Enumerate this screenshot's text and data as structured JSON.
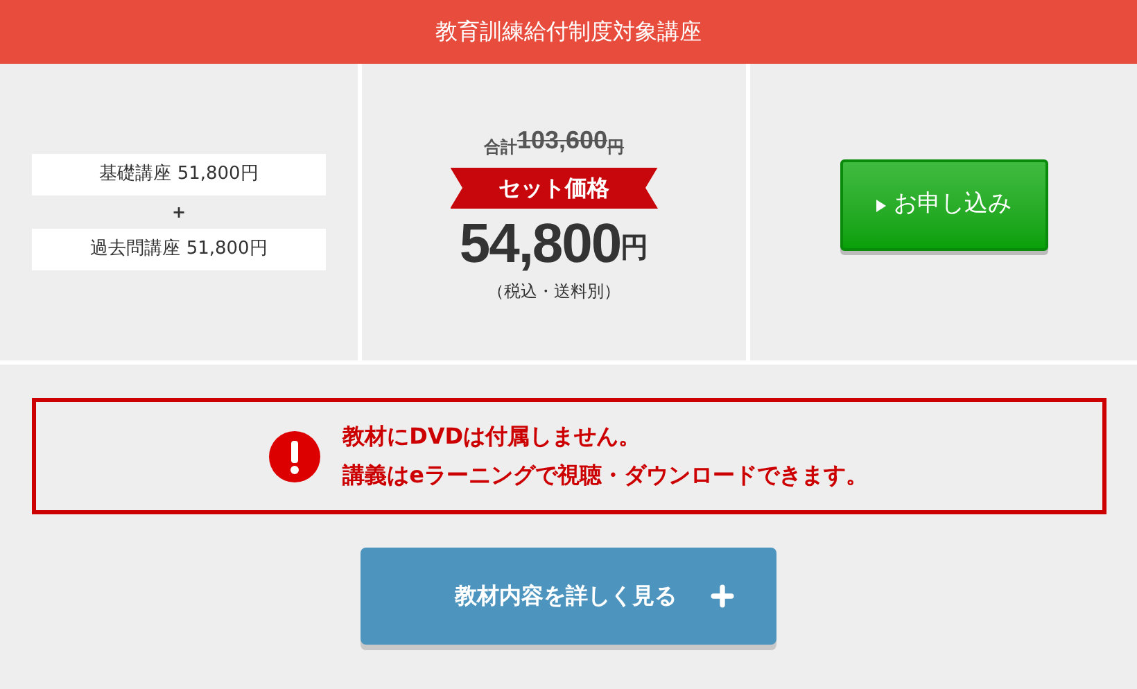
{
  "header": {
    "title": "教育訓練給付制度対象講座"
  },
  "courses": [
    {
      "text": "基礎講座 51,800円"
    },
    {
      "text": "過去問講座 51,800円"
    }
  ],
  "plus_sign": "+",
  "pricing": {
    "total_label": "合計",
    "original_amount": "103,600",
    "original_unit": "円",
    "ribbon": "セット価格",
    "price": "54,800",
    "price_unit": "円",
    "note": "（税込・送料別）"
  },
  "apply_button": {
    "label": "お申し込み"
  },
  "notice": {
    "lines": [
      "教材にDVDは付属しません。",
      "講義はeラーニングで視聴・ダウンロードできます。"
    ]
  },
  "details_button": {
    "label": "教材内容を詳しく見る"
  }
}
